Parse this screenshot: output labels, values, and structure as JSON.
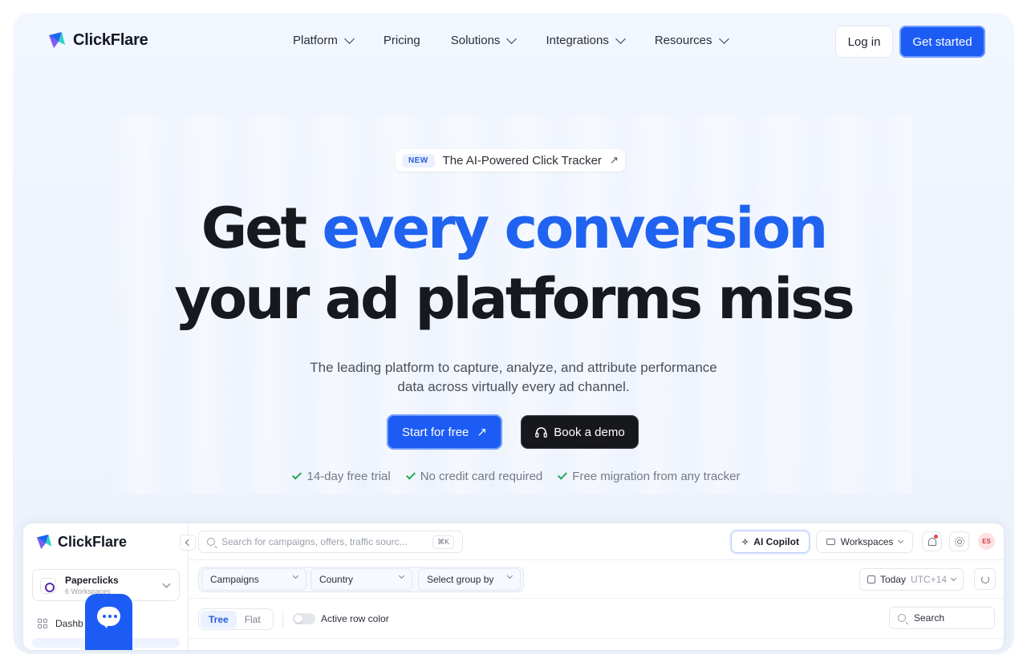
{
  "nav": {
    "brand": "ClickFlare",
    "links": [
      "Platform",
      "Pricing",
      "Solutions",
      "Integrations",
      "Resources"
    ],
    "login": "Log in",
    "get_started": "Get started"
  },
  "hero": {
    "badge_tag": "NEW",
    "badge_text": "The AI-Powered Click Tracker",
    "badge_arrow": "↗",
    "headline_1a": "Get ",
    "headline_1b": "every conversion",
    "headline_2": "your ad platforms miss",
    "sub_1": "The leading platform to capture, analyze, and attribute performance",
    "sub_2": "data across virtually every ad channel.",
    "cta_primary": "Start for free",
    "cta_primary_arrow": "↗",
    "cta_secondary": "Book a demo",
    "checks": [
      "14-day free trial",
      "No credit card required",
      "Free migration from any tracker"
    ]
  },
  "app": {
    "brand": "ClickFlare",
    "workspace_name": "Paperclicks",
    "workspace_count": "6 Workspaces",
    "sidebar_item": "Dashb",
    "search_placeholder": "Search for campaigns, offers, traffic sourc...",
    "search_shortcut": "⌘K",
    "ai_copilot": "AI Copilot",
    "workspaces": "Workspaces",
    "avatar_initials": "ES",
    "filters": [
      "Campaigns",
      "Country",
      "Select group by"
    ],
    "date_label": "Today",
    "timezone": "UTC+14",
    "view_modes": [
      "Tree",
      "Flat"
    ],
    "toggle_label": "Active row color",
    "table_search": "Search"
  },
  "colors": {
    "accent": "#1c5cf5",
    "headline_blue": "#1f63f0",
    "check_green": "#1fa855"
  }
}
